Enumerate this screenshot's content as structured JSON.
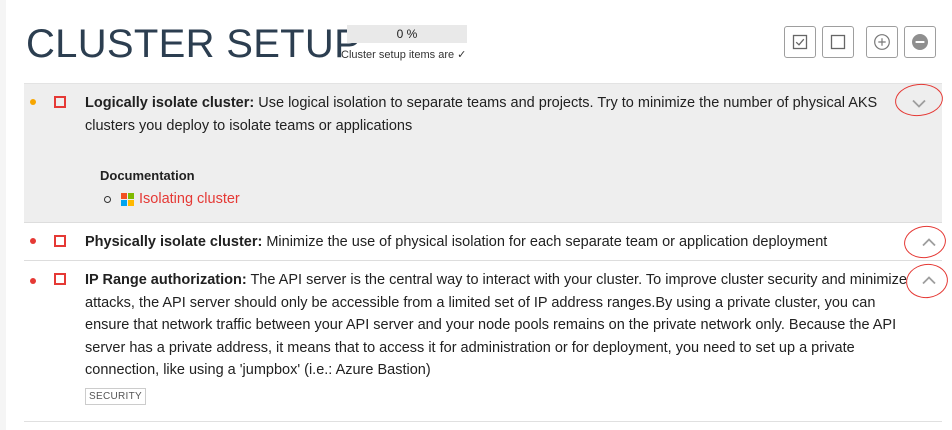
{
  "header": {
    "title": "CLUSTER SETUP",
    "progress_label": "0 %",
    "progress_value": 0,
    "progress_note": "Cluster setup items are ✓"
  },
  "toolbar": {
    "check_all_icon": "checked-box-icon",
    "uncheck_all_icon": "empty-box-icon",
    "expand_all_icon": "plus-circle-icon",
    "collapse_all_icon": "minus-circle-icon"
  },
  "items": [
    {
      "severity_color": "#f7a600",
      "title": "Logically isolate cluster:",
      "description": "Use logical isolation to separate teams and projects. Try to minimize the number of physical AKS clusters you deploy to isolate teams or applications",
      "documentation_heading": "Documentation",
      "documentation_link": "Isolating cluster",
      "toggle_icon": "chevron-down-icon"
    },
    {
      "severity_color": "#e53935",
      "title": "Physically isolate cluster:",
      "description": "Minimize the use of physical isolation for each separate team or application deployment",
      "toggle_icon": "chevron-up-icon"
    },
    {
      "severity_color": "#e53935",
      "title": "IP Range authorization:",
      "description": "The API server is the central way to interact with your cluster. To improve cluster security and minimize attacks, the API server should only be accessible from a limited set of IP address ranges.By using a private cluster, you can ensure that network traffic between your API server and your node pools remains on the private network only. Because the API server has a private address, it means that to access it for administration or for deployment, you need to set up a private connection, like using a 'jumpbox' (i.e.: Azure Bastion)",
      "tag": "SECURITY",
      "toggle_icon": "chevron-up-icon"
    }
  ],
  "colors": {
    "accent": "#e53935",
    "title": "#2c3e50",
    "expanded_bg": "#eeeeee"
  }
}
